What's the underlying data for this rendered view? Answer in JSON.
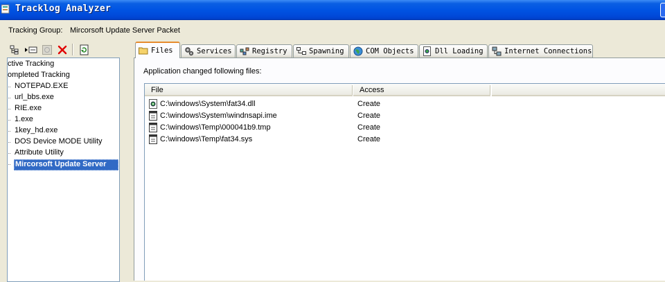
{
  "window": {
    "title": "Tracklog Analyzer"
  },
  "group": {
    "label": "Tracking Group:",
    "value": "Mircorsoft Update Server Packet"
  },
  "toolbar": {
    "icons": [
      "tree-view-icon",
      "expand-icon",
      "stop-icon",
      "delete-icon",
      "refresh-icon"
    ],
    "delete_color": "#e00000"
  },
  "tree": {
    "items": [
      "ctive Tracking",
      "ompleted Tracking",
      "NOTEPAD.EXE",
      "url_bbs.exe",
      "RIE.exe",
      "1.exe",
      "1key_hd.exe",
      "DOS Device MODE Utility",
      "Attribute Utility"
    ],
    "selected": "Mircorsoft Update Server",
    "selection_color": "#316ac5"
  },
  "tabs": [
    {
      "label": "Files",
      "icon": "folder-icon",
      "active": true
    },
    {
      "label": "Services",
      "icon": "gears-icon"
    },
    {
      "label": "Registry",
      "icon": "registry-icon"
    },
    {
      "label": "Spawning",
      "icon": "spawn-tree-icon"
    },
    {
      "label": "COM Objects",
      "icon": "globe-icon"
    },
    {
      "label": "Dll Loading",
      "icon": "dll-page-icon"
    },
    {
      "label": "Internet Connections",
      "icon": "network-icon"
    }
  ],
  "files": {
    "heading": "Application changed following files:",
    "columns": [
      "File",
      "Access"
    ],
    "rows": [
      {
        "file": "C:\\windows\\System\\fat34.dll",
        "access": "Create",
        "icon": "dll-file-icon"
      },
      {
        "file": "C:\\windows\\System\\windnsapi.ime",
        "access": "Create",
        "icon": "file-icon"
      },
      {
        "file": "C:\\windows\\Temp\\000041b9.tmp",
        "access": "Create",
        "icon": "file-icon"
      },
      {
        "file": "C:\\windows\\Temp\\fat34.sys",
        "access": "Create",
        "icon": "file-icon"
      }
    ]
  },
  "colors": {
    "titlebar": "#0054e3",
    "active_tab_accent": "#e68b2c",
    "panel": "#ece9d8"
  }
}
